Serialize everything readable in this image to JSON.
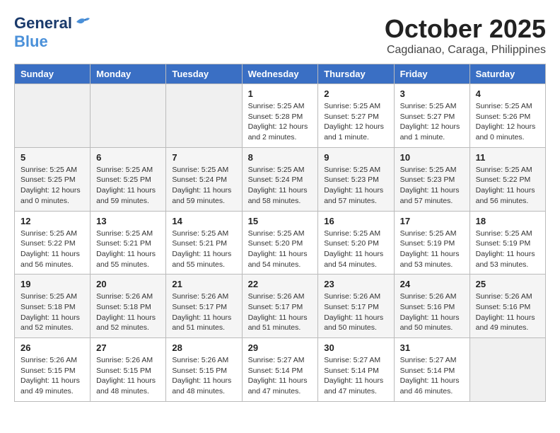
{
  "header": {
    "logo_general": "General",
    "logo_blue": "Blue",
    "month_title": "October 2025",
    "location": "Cagdianao, Caraga, Philippines"
  },
  "weekdays": [
    "Sunday",
    "Monday",
    "Tuesday",
    "Wednesday",
    "Thursday",
    "Friday",
    "Saturday"
  ],
  "weeks": [
    [
      {
        "day": "",
        "info": ""
      },
      {
        "day": "",
        "info": ""
      },
      {
        "day": "",
        "info": ""
      },
      {
        "day": "1",
        "info": "Sunrise: 5:25 AM\nSunset: 5:28 PM\nDaylight: 12 hours\nand 2 minutes."
      },
      {
        "day": "2",
        "info": "Sunrise: 5:25 AM\nSunset: 5:27 PM\nDaylight: 12 hours\nand 1 minute."
      },
      {
        "day": "3",
        "info": "Sunrise: 5:25 AM\nSunset: 5:27 PM\nDaylight: 12 hours\nand 1 minute."
      },
      {
        "day": "4",
        "info": "Sunrise: 5:25 AM\nSunset: 5:26 PM\nDaylight: 12 hours\nand 0 minutes."
      }
    ],
    [
      {
        "day": "5",
        "info": "Sunrise: 5:25 AM\nSunset: 5:25 PM\nDaylight: 12 hours\nand 0 minutes."
      },
      {
        "day": "6",
        "info": "Sunrise: 5:25 AM\nSunset: 5:25 PM\nDaylight: 11 hours\nand 59 minutes."
      },
      {
        "day": "7",
        "info": "Sunrise: 5:25 AM\nSunset: 5:24 PM\nDaylight: 11 hours\nand 59 minutes."
      },
      {
        "day": "8",
        "info": "Sunrise: 5:25 AM\nSunset: 5:24 PM\nDaylight: 11 hours\nand 58 minutes."
      },
      {
        "day": "9",
        "info": "Sunrise: 5:25 AM\nSunset: 5:23 PM\nDaylight: 11 hours\nand 57 minutes."
      },
      {
        "day": "10",
        "info": "Sunrise: 5:25 AM\nSunset: 5:23 PM\nDaylight: 11 hours\nand 57 minutes."
      },
      {
        "day": "11",
        "info": "Sunrise: 5:25 AM\nSunset: 5:22 PM\nDaylight: 11 hours\nand 56 minutes."
      }
    ],
    [
      {
        "day": "12",
        "info": "Sunrise: 5:25 AM\nSunset: 5:22 PM\nDaylight: 11 hours\nand 56 minutes."
      },
      {
        "day": "13",
        "info": "Sunrise: 5:25 AM\nSunset: 5:21 PM\nDaylight: 11 hours\nand 55 minutes."
      },
      {
        "day": "14",
        "info": "Sunrise: 5:25 AM\nSunset: 5:21 PM\nDaylight: 11 hours\nand 55 minutes."
      },
      {
        "day": "15",
        "info": "Sunrise: 5:25 AM\nSunset: 5:20 PM\nDaylight: 11 hours\nand 54 minutes."
      },
      {
        "day": "16",
        "info": "Sunrise: 5:25 AM\nSunset: 5:20 PM\nDaylight: 11 hours\nand 54 minutes."
      },
      {
        "day": "17",
        "info": "Sunrise: 5:25 AM\nSunset: 5:19 PM\nDaylight: 11 hours\nand 53 minutes."
      },
      {
        "day": "18",
        "info": "Sunrise: 5:25 AM\nSunset: 5:19 PM\nDaylight: 11 hours\nand 53 minutes."
      }
    ],
    [
      {
        "day": "19",
        "info": "Sunrise: 5:25 AM\nSunset: 5:18 PM\nDaylight: 11 hours\nand 52 minutes."
      },
      {
        "day": "20",
        "info": "Sunrise: 5:26 AM\nSunset: 5:18 PM\nDaylight: 11 hours\nand 52 minutes."
      },
      {
        "day": "21",
        "info": "Sunrise: 5:26 AM\nSunset: 5:17 PM\nDaylight: 11 hours\nand 51 minutes."
      },
      {
        "day": "22",
        "info": "Sunrise: 5:26 AM\nSunset: 5:17 PM\nDaylight: 11 hours\nand 51 minutes."
      },
      {
        "day": "23",
        "info": "Sunrise: 5:26 AM\nSunset: 5:17 PM\nDaylight: 11 hours\nand 50 minutes."
      },
      {
        "day": "24",
        "info": "Sunrise: 5:26 AM\nSunset: 5:16 PM\nDaylight: 11 hours\nand 50 minutes."
      },
      {
        "day": "25",
        "info": "Sunrise: 5:26 AM\nSunset: 5:16 PM\nDaylight: 11 hours\nand 49 minutes."
      }
    ],
    [
      {
        "day": "26",
        "info": "Sunrise: 5:26 AM\nSunset: 5:15 PM\nDaylight: 11 hours\nand 49 minutes."
      },
      {
        "day": "27",
        "info": "Sunrise: 5:26 AM\nSunset: 5:15 PM\nDaylight: 11 hours\nand 48 minutes."
      },
      {
        "day": "28",
        "info": "Sunrise: 5:26 AM\nSunset: 5:15 PM\nDaylight: 11 hours\nand 48 minutes."
      },
      {
        "day": "29",
        "info": "Sunrise: 5:27 AM\nSunset: 5:14 PM\nDaylight: 11 hours\nand 47 minutes."
      },
      {
        "day": "30",
        "info": "Sunrise: 5:27 AM\nSunset: 5:14 PM\nDaylight: 11 hours\nand 47 minutes."
      },
      {
        "day": "31",
        "info": "Sunrise: 5:27 AM\nSunset: 5:14 PM\nDaylight: 11 hours\nand 46 minutes."
      },
      {
        "day": "",
        "info": ""
      }
    ]
  ]
}
